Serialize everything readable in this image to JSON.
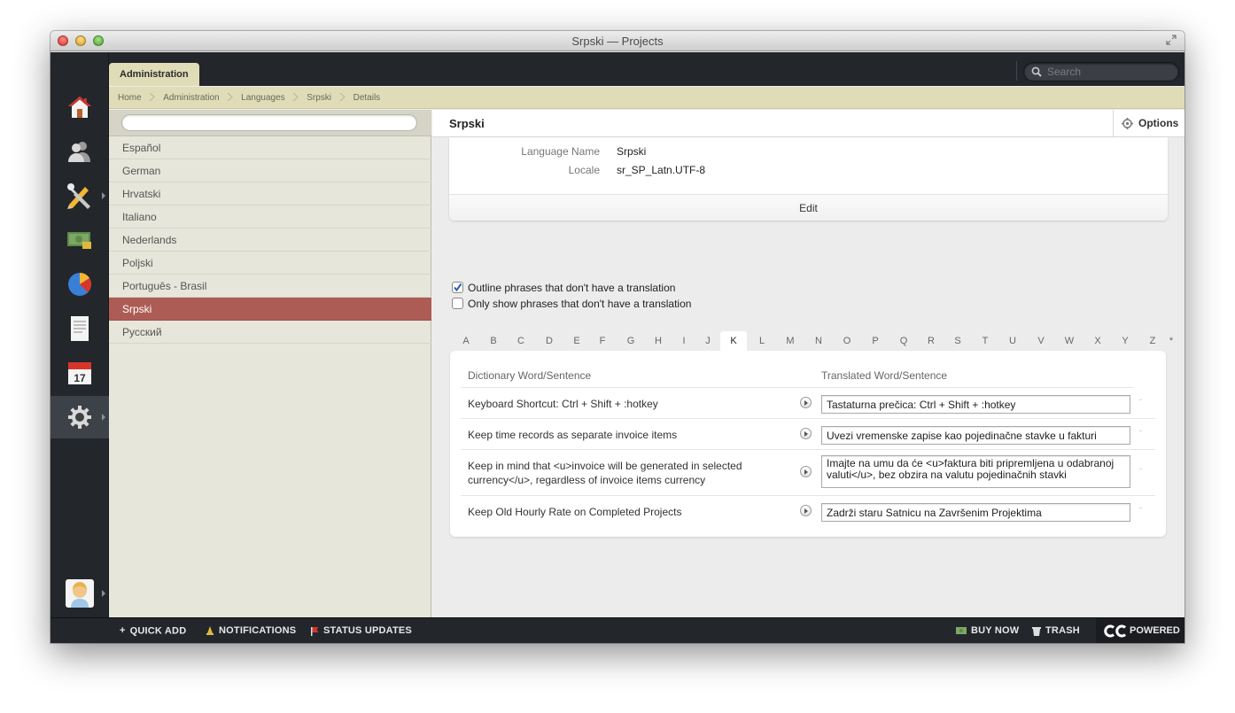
{
  "window": {
    "title": "Srpski — Projects"
  },
  "topbar": {
    "tab_label": "Administration",
    "search_placeholder": "Search"
  },
  "breadcrumb": [
    "Home",
    "Administration",
    "Languages",
    "Srpski",
    "Details"
  ],
  "sidebar_icons": [
    "home-icon",
    "people-icon",
    "tools-icon",
    "money-icon",
    "pie-chart-icon",
    "document-icon",
    "calendar-icon",
    "gear-icon",
    "avatar-icon"
  ],
  "calendar_day": "17",
  "languages": {
    "items": [
      "Español",
      "German",
      "Hrvatski",
      "Italiano",
      "Nederlands",
      "Poljski",
      "Português - Brasil",
      "Srpski",
      "Русский"
    ],
    "selected": "Srpski"
  },
  "main": {
    "title": "Srpski",
    "options_label": "Options",
    "details": {
      "language_name_label": "Language Name",
      "language_name_value": "Srpski",
      "locale_label": "Locale",
      "locale_value": "sr_SP_Latn.UTF-8",
      "edit_label": "Edit"
    },
    "checkboxes": [
      {
        "label": "Outline phrases that don't have a translation",
        "checked": true
      },
      {
        "label": "Only show phrases that don't have a translation",
        "checked": false
      }
    ],
    "letters": [
      "A",
      "B",
      "C",
      "D",
      "E",
      "F",
      "G",
      "H",
      "I",
      "J",
      "K",
      "L",
      "M",
      "N",
      "O",
      "P",
      "Q",
      "R",
      "S",
      "T",
      "U",
      "V",
      "W",
      "X",
      "Y",
      "Z",
      "*"
    ],
    "active_letter": "K",
    "dictionary": {
      "col_source": "Dictionary Word/Sentence",
      "col_translation": "Translated Word/Sentence",
      "rows": [
        {
          "source": "Keyboard Shortcut: Ctrl + Shift + :hotkey",
          "translation": "Tastaturna prečica: Ctrl + Shift + :hotkey"
        },
        {
          "source": "Keep time records as separate invoice items",
          "translation": "Uvezi vremenske zapise kao pojedinačne stavke u fakturi"
        },
        {
          "source": "Keep in mind that <u>invoice will be generated in selected currency</u>, regardless of invoice items currency",
          "translation": "Imajte na umu da će <u>faktura biti pripremljena u odabranoj valuti</u>, bez obzira na valutu pojedinačnih stavki"
        },
        {
          "source": "Keep Old Hourly Rate on Completed Projects",
          "translation": "Zadrži staru Satnicu na Završenim Projektima"
        }
      ]
    }
  },
  "footer": {
    "quick_add": "QUICK ADD",
    "notifications": "NOTIFICATIONS",
    "status_updates": "STATUS UPDATES",
    "buy_now": "BUY NOW",
    "trash": "TRASH",
    "powered": "POWERED"
  },
  "colors": {
    "selected_row": "#ad5c55",
    "breadcrumb_bg": "#dfdcb7",
    "dark_bar": "#23262b"
  }
}
